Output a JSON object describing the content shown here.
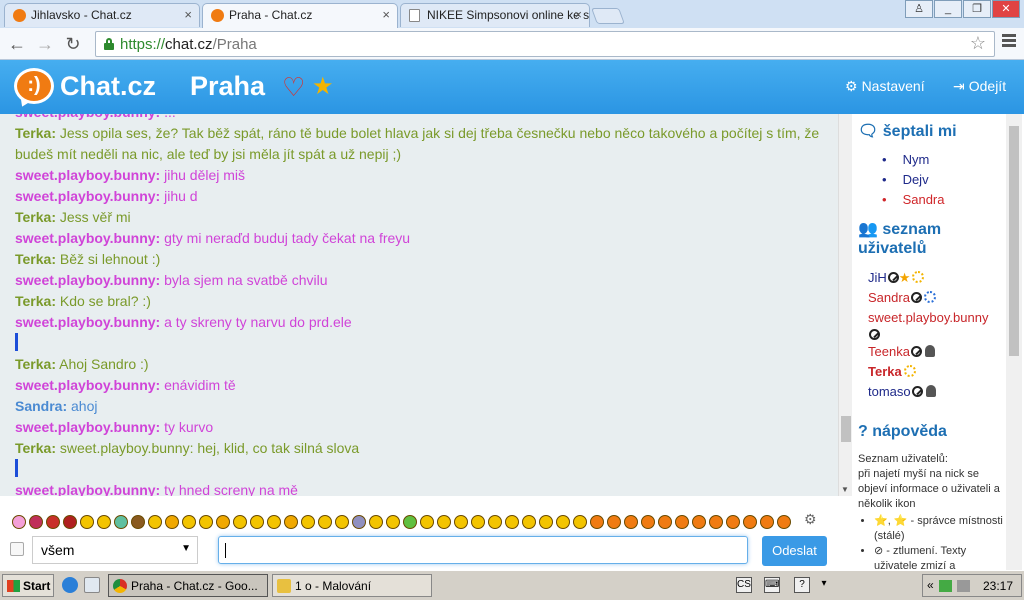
{
  "browser": {
    "tabs": [
      {
        "title": "Jihlavsko - Chat.cz",
        "close": "×"
      },
      {
        "title": "Praha - Chat.cz",
        "close": "×"
      },
      {
        "title": "NIKEE Simpsonovi online ke s",
        "close": "×"
      }
    ],
    "url": {
      "proto": "https://",
      "host": "chat.cz",
      "path": "/Praha"
    }
  },
  "header": {
    "logo": "Chat.cz",
    "logo_glyph": ":)",
    "room": "Praha",
    "settings": "Nastavení",
    "logout": "Odejít"
  },
  "messages": [
    {
      "nick": "Terka:",
      "text": " Jess opila ses, že? Tak běž spát, ráno tě bude bolet hlava jak si dej třeba česnečku nebo něco takového a počítej s tím, že budeš mít neděli na nic, ale teď by jsi měla jít spát a už nepij ;)"
    },
    {
      "nick": "sweet.playboy.bunny:",
      "text": " jihu dělej miš"
    },
    {
      "nick": "sweet.playboy.bunny:",
      "text": " jihu d"
    },
    {
      "nick": "Terka:",
      "text": " Jess věř mi"
    },
    {
      "nick": "sweet.playboy.bunny:",
      "text": " gty mi neraďd buduj tady čekat na freyu"
    },
    {
      "nick": "Terka:",
      "text": " Běž si lehnout :)"
    },
    {
      "nick": "sweet.playboy.bunny:",
      "text": " byla sjem na svatbě chvilu"
    },
    {
      "nick": "Terka:",
      "text": " Kdo se bral? :)"
    },
    {
      "nick": "sweet.playboy.bunny:",
      "text": " a ty skreny ty narvu do prd.ele"
    },
    {
      "nick": "Terka:",
      "text": " Ahoj Sandro :)"
    },
    {
      "nick": "sweet.playboy.bunny:",
      "text": " enávidim tě"
    },
    {
      "nick": "Sandra:",
      "text": " ahoj"
    },
    {
      "nick": "sweet.playboy.bunny:",
      "text": " ty kurvo"
    },
    {
      "nick": "Terka:",
      "text": " sweet.playboy.bunny: hej, klid, co tak silná slova"
    },
    {
      "nick": "sweet.playboy.bunny:",
      "text": " ty hned screny na mě"
    }
  ],
  "sidebar": {
    "whispers_title": "šeptali mi",
    "whispers": [
      "Nym",
      "Dejv",
      "Sandra"
    ],
    "users_title_1": "seznam",
    "users_title_2": "uživatelů",
    "users": [
      "JiH",
      "Sandra",
      "sweet.playboy.bunny",
      "Teenka",
      "Terka",
      "tomaso"
    ],
    "help_title": "nápověda",
    "help_intro": "Seznam uživatelů:",
    "help_line": "při najetí myší na nick se objeví informace o uživateli a několik ikon",
    "help_items": [
      "⭐, ⭐ - správce místnosti (stálé)",
      "⊘ - ztlumení. Texty uživatele zmizí a"
    ]
  },
  "input": {
    "recipient": "všem",
    "send": "Odeslat"
  },
  "taskbar": {
    "start": "Start",
    "tasks": [
      "Praha - Chat.cz - Goo...",
      "1 o - Malování"
    ],
    "lang": "CS",
    "clock": "23:17"
  },
  "colors": {
    "header_blue": "#2b95e3",
    "bunny_pink": "#d044d8",
    "terka_green": "#7a9a2a",
    "sandra_blue": "#4a8ad2",
    "logo_orange": "#f07b12"
  }
}
